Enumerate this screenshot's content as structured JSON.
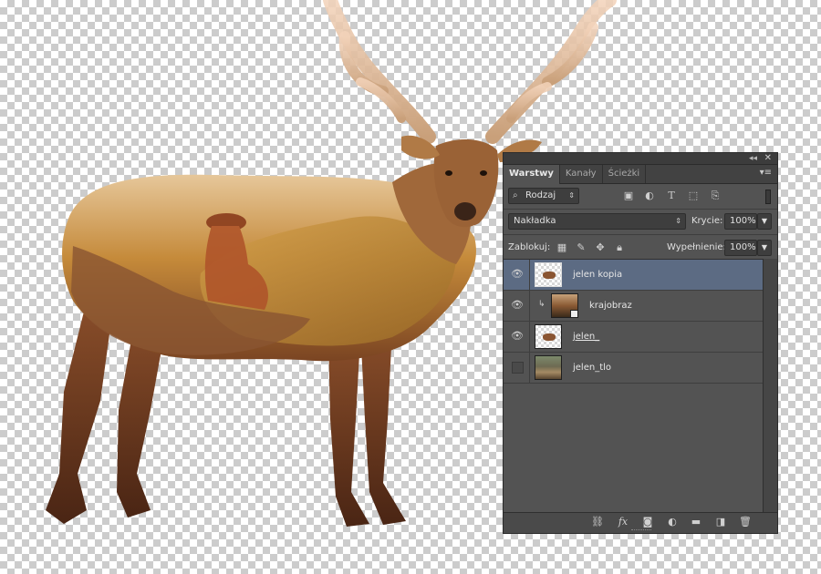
{
  "panel": {
    "tabs": [
      {
        "label": "Warstwy",
        "active": true
      },
      {
        "label": "Kanały",
        "active": false
      },
      {
        "label": "Ścieżki",
        "active": false
      }
    ],
    "filter": {
      "kind_label": "Rodzaj",
      "kind_icon": "search-icon",
      "type_icons": [
        "image-icon",
        "adjustment-icon",
        "text-icon",
        "shape-icon",
        "smart-object-icon"
      ]
    },
    "blend": {
      "mode": "Nakładka",
      "opacity_label": "Krycie:",
      "opacity_value": "100%"
    },
    "lock": {
      "label": "Zablokuj:",
      "icons": [
        "lock-transparent-icon",
        "lock-paint-icon",
        "lock-position-icon",
        "lock-all-icon"
      ],
      "fill_label": "Wypełnienie:",
      "fill_value": "100%"
    },
    "layers": [
      {
        "name": "jelen kopia",
        "visible": true,
        "selected": true,
        "thumb": "deer-thumb",
        "clipped": false,
        "underline": false
      },
      {
        "name": "krajobraz",
        "visible": true,
        "selected": false,
        "thumb": "landscape-thumb",
        "clipped": true,
        "underline": false
      },
      {
        "name": "jelen_",
        "visible": true,
        "selected": false,
        "thumb": "deer-thumb",
        "clipped": false,
        "underline": true
      },
      {
        "name": "jelen_tlo",
        "visible": false,
        "selected": false,
        "thumb": "photo-thumb",
        "clipped": false,
        "underline": false
      }
    ],
    "bottom_icons": [
      "link-icon",
      "fx-icon",
      "mask-icon",
      "adjustment-layer-icon",
      "folder-icon",
      "new-layer-icon",
      "trash-icon"
    ],
    "fx_label": "fx"
  },
  "colors": {
    "panel_bg": "#535353",
    "selected_row": "#5c6b83"
  }
}
